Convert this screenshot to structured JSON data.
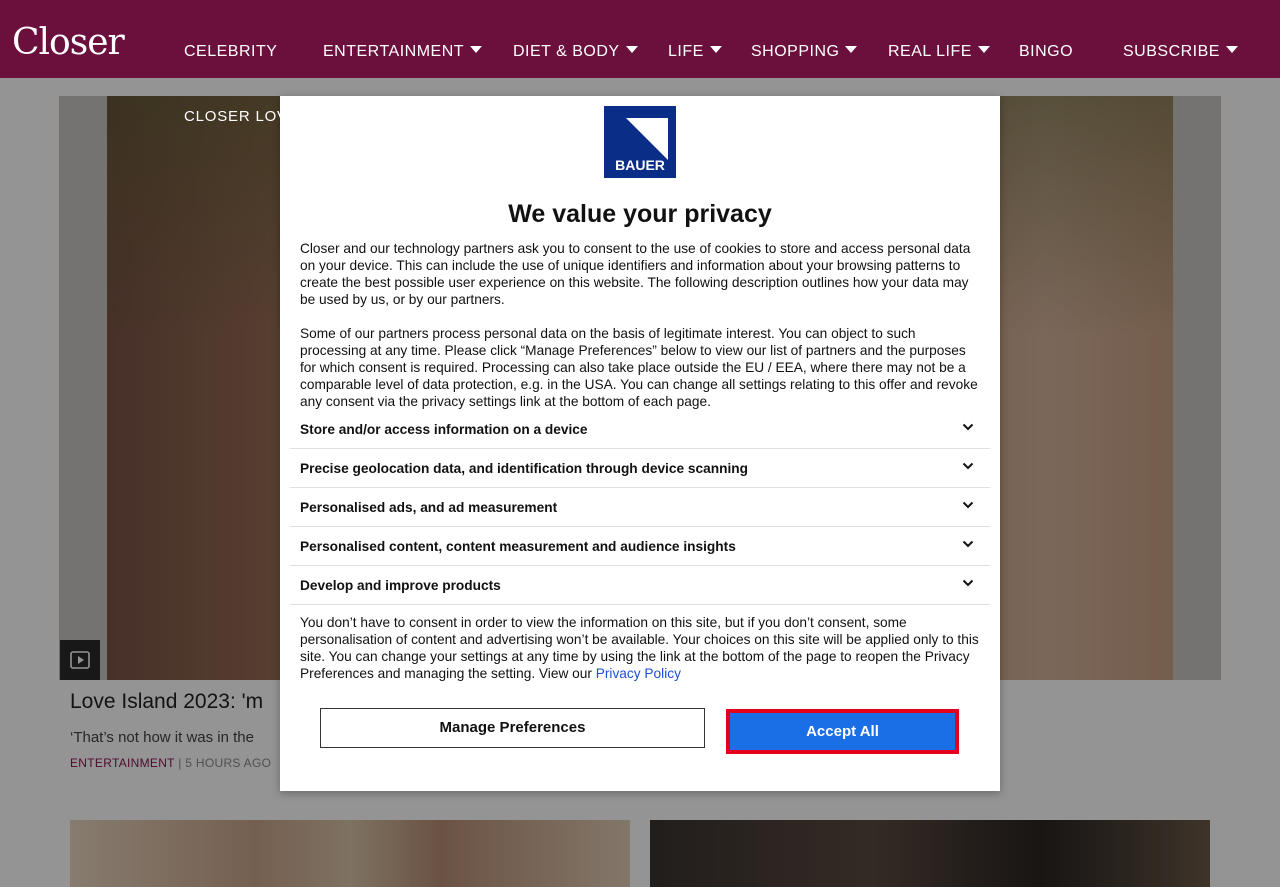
{
  "header": {
    "logo_text": "Closer",
    "nav": [
      {
        "label": "CELEBRITY",
        "has_dropdown": false
      },
      {
        "label": "ENTERTAINMENT",
        "has_dropdown": true
      },
      {
        "label": "DIET & BODY",
        "has_dropdown": true
      },
      {
        "label": "LIFE",
        "has_dropdown": true
      },
      {
        "label": "SHOPPING",
        "has_dropdown": true
      },
      {
        "label": "REAL LIFE",
        "has_dropdown": true
      },
      {
        "label": "BINGO",
        "has_dropdown": false
      },
      {
        "label": "SUBSCRIBE",
        "has_dropdown": true
      }
    ]
  },
  "hero": {
    "label": "CLOSER LOV",
    "headline": "Love Island 2023: 'm",
    "subline": "‘That’s not how it was in the",
    "category": "ENTERTAINMENT",
    "separator": " | ",
    "time": "5 HOURS AGO",
    "play_icon": "play-icon"
  },
  "consent": {
    "logo_text": "BAUER",
    "title": "We value your privacy",
    "intro": "Closer and our technology partners ask you to consent to the use of cookies to store and access personal data on your device. This can include the use of unique identifiers and information about your browsing patterns to create the best possible user experience on this website. The following description outlines how your data may be used by us, or by our partners.",
    "legitimate_interest": "Some of our partners process personal data on the basis of legitimate interest. You can object to such processing at any time. Please click “Manage Preferences” below to view our list of partners and the purposes for which consent is required. Processing can also take place outside the EU / EEA, where there may not be a comparable level of data protection, e.g. in the USA. You can change all settings relating to this offer and revoke any consent via the privacy settings link at the bottom of each page.",
    "purposes": [
      "Store and/or access information on a device",
      "Precise geolocation data, and identification through device scanning",
      "Personalised ads, and ad measurement",
      "Personalised content, content measurement and audience insights",
      "Develop and improve products"
    ],
    "footer_text": "You don’t have to consent in order to view the information on this site, but if you don’t consent, some personalisation of content and advertising won’t be available. Your choices on this site will be applied only to this site. You can change your settings at any time by using the link at the bottom of the page to reopen the Privacy Preferences and managing the setting. View our ",
    "privacy_link": "Privacy Policy",
    "manage_label": "Manage Preferences",
    "accept_label": "Accept All"
  },
  "colors": {
    "header_bg": "#6b0f3d",
    "bauer_blue": "#0a2d87",
    "accept_bg": "#1a6fe6",
    "accept_border": "#e4001b",
    "link": "#1a4fd6",
    "category": "#8a1450"
  }
}
